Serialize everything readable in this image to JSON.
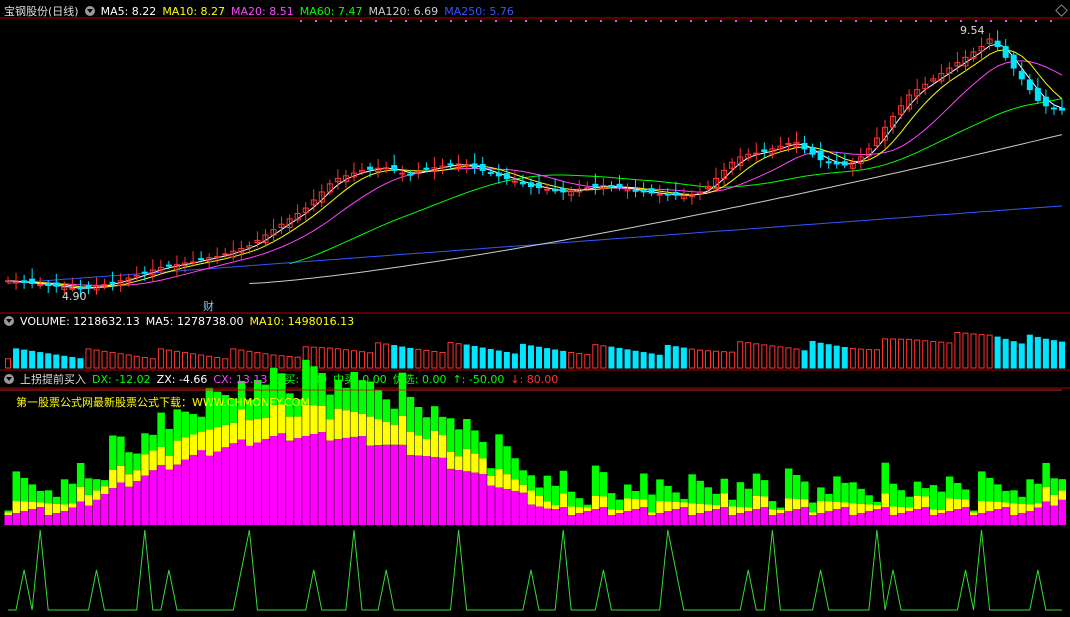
{
  "main_panel": {
    "stock_name": "宝钢股份(日线)",
    "indicators": [
      {
        "label": "MA5: 8.22",
        "color": "#ffffff"
      },
      {
        "label": "MA10: 8.27",
        "color": "#ffff00"
      },
      {
        "label": "MA20: 8.51",
        "color": "#ff44ff"
      },
      {
        "label": "MA60: 7.47",
        "color": "#00ff00"
      },
      {
        "label": "MA120: 6.69",
        "color": "#cccccc"
      },
      {
        "label": "MA250: 5.76",
        "color": "#3355ff"
      }
    ],
    "high_label": "9.54",
    "low_label": "4.90",
    "marker_label": "财"
  },
  "volume_panel": {
    "indicators": [
      {
        "label": "VOLUME: 1218632.13",
        "color": "#ffffff"
      },
      {
        "label": "MA5: 1278738.00",
        "color": "#ffffff"
      },
      {
        "label": "MA10: 1498016.13",
        "color": "#ffff00"
      }
    ]
  },
  "indicator_panel": {
    "name": "上拐提前买入",
    "indicators": [
      {
        "label": "DX: -12.02",
        "color": "#00ff00"
      },
      {
        "label": "ZX: -4.66",
        "color": "#ffffff"
      },
      {
        "label": "CX: 13.13",
        "color": "#ff44ff"
      },
      {
        "label": "短买: 0.00",
        "color": "#00ff00"
      },
      {
        "label": "中买: 0.00",
        "color": "#00ff00"
      },
      {
        "label": "优选: 0.00",
        "color": "#00ff00"
      },
      {
        "label": "↑: -50.00",
        "color": "#00ff00"
      },
      {
        "label": "↓: 80.00",
        "color": "#ff3333"
      }
    ],
    "watermark": "第一股票公式网最新股票公式下载：WWW.CHMONEY.COM"
  },
  "colors": {
    "up": "#ff3333",
    "down": "#00e5ff",
    "panel_border": "#b00000",
    "green_area": "#00ff00",
    "yellow_area": "#ffff00",
    "magenta_area": "#ff00ff"
  },
  "chart_data": {
    "type": "candlestick",
    "price_series": [
      5.05,
      5.03,
      5.02,
      5.0,
      4.98,
      4.97,
      4.95,
      4.93,
      4.91,
      4.9,
      4.92,
      4.95,
      4.98,
      5.02,
      5.05,
      5.1,
      5.15,
      5.2,
      5.25,
      5.3,
      5.32,
      5.35,
      5.38,
      5.4,
      5.45,
      5.48,
      5.5,
      5.55,
      5.6,
      5.65,
      5.7,
      5.8,
      5.9,
      6.0,
      6.1,
      6.2,
      6.3,
      6.4,
      6.55,
      6.7,
      6.85,
      6.95,
      7.0,
      7.05,
      7.1,
      7.12,
      7.14,
      7.15,
      7.1,
      7.05,
      7.02,
      7.08,
      7.12,
      7.15,
      7.18,
      7.2,
      7.22,
      7.2,
      7.15,
      7.1,
      7.05,
      7.0,
      6.95,
      6.9,
      6.85,
      6.8,
      6.78,
      6.75,
      6.72,
      6.7,
      6.72,
      6.75,
      6.78,
      6.8,
      6.82,
      6.8,
      6.78,
      6.75,
      6.72,
      6.7,
      6.68,
      6.66,
      6.65,
      6.64,
      6.63,
      6.65,
      6.7,
      6.8,
      6.95,
      7.1,
      7.25,
      7.35,
      7.4,
      7.42,
      7.45,
      7.5,
      7.55,
      7.6,
      7.62,
      7.5,
      7.4,
      7.3,
      7.25,
      7.22,
      7.2,
      7.25,
      7.35,
      7.5,
      7.7,
      7.9,
      8.1,
      8.3,
      8.5,
      8.6,
      8.7,
      8.8,
      8.9,
      9.0,
      9.1,
      9.2,
      9.3,
      9.4,
      9.54,
      9.4,
      9.2,
      9.0,
      8.8,
      8.6,
      8.4,
      8.3,
      8.25,
      8.22
    ]
  }
}
